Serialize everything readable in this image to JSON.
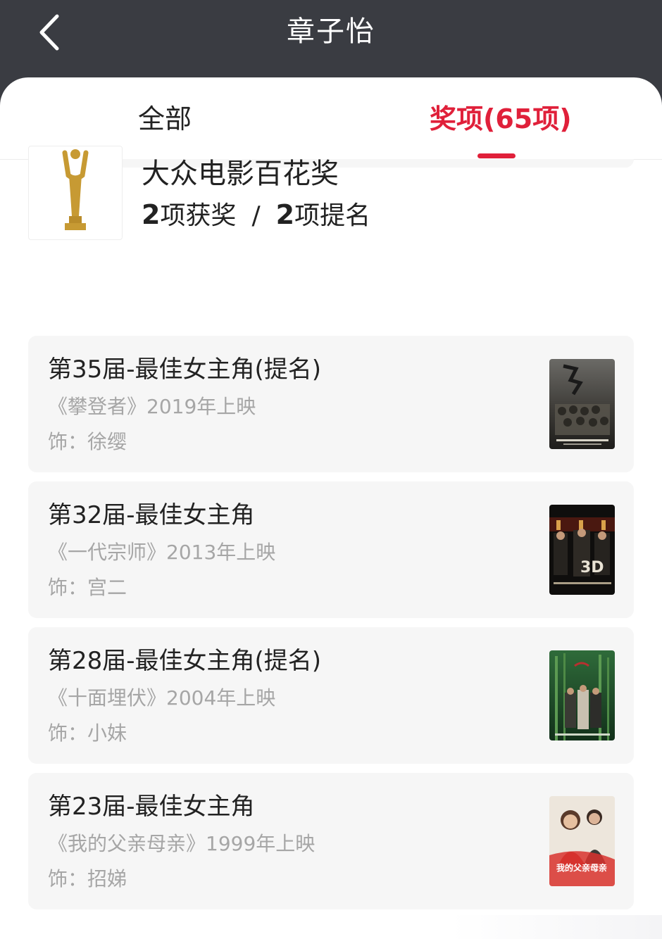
{
  "header": {
    "title": "章子怡"
  },
  "tabs": [
    {
      "label": "全部",
      "active": false
    },
    {
      "label": "奖项(65项)",
      "active": true
    }
  ],
  "colors": {
    "accent": "#e0203a",
    "header_bg": "#3a3c42",
    "card_bg": "#f6f6f6",
    "muted_text": "#a6a6a6"
  },
  "award": {
    "icon": "trophy-icon",
    "name": "大众电影百花奖",
    "wins_count": "2",
    "wins_label": "项获奖",
    "separator": "/",
    "noms_count": "2",
    "noms_label": "项提名"
  },
  "items": [
    {
      "title": "第35届-最佳女主角(提名)",
      "film": "《攀登者》2019年上映",
      "role": "饰：徐缨",
      "poster": "poster-the-climbers"
    },
    {
      "title": "第32届-最佳女主角",
      "film": "《一代宗师》2013年上映",
      "role": "饰：宫二",
      "poster": "poster-the-grandmaster"
    },
    {
      "title": "第28届-最佳女主角(提名)",
      "film": "《十面埋伏》2004年上映",
      "role": "饰：小妹",
      "poster": "poster-house-of-flying-daggers"
    },
    {
      "title": "第23届-最佳女主角",
      "film": "《我的父亲母亲》1999年上映",
      "role": "饰：招娣",
      "poster": "poster-the-road-home"
    }
  ],
  "poster_texts": {
    "road_home": "我的父亲母亲"
  }
}
